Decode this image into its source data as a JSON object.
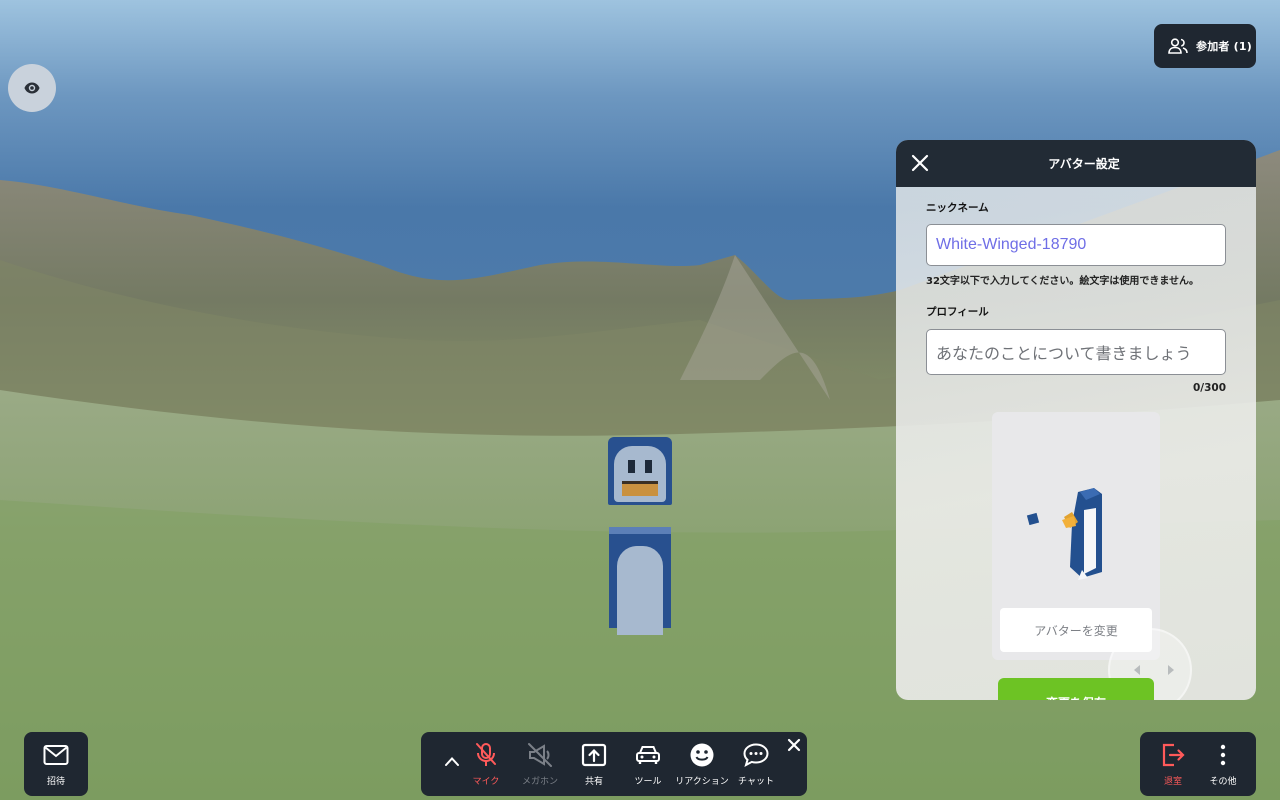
{
  "participants": {
    "label": "参加者 (1)"
  },
  "avatar_panel": {
    "title": "アバター設定",
    "nickname_label": "ニックネーム",
    "nickname_value": "White-Winged-18790",
    "nickname_hint": "32文字以下で入力してください。絵文字は使用できません。",
    "profile_label": "プロフィール",
    "profile_placeholder": "あなたのことについて書きましょう",
    "profile_counter": "0/300",
    "change_avatar_label": "アバターを変更",
    "save_label": "変更を保存"
  },
  "bottom_left": {
    "invite_label": "招待"
  },
  "toolbar": {
    "items": [
      {
        "label": "マイク",
        "icon": "mic-off-icon"
      },
      {
        "label": "メガホン",
        "icon": "megaphone-off-icon"
      },
      {
        "label": "共有",
        "icon": "share-screen-icon"
      },
      {
        "label": "ツール",
        "icon": "car-icon"
      },
      {
        "label": "リアクション",
        "icon": "smile-icon"
      },
      {
        "label": "チャット",
        "icon": "chat-icon"
      }
    ]
  },
  "bottom_right": {
    "leave_label": "退室",
    "more_label": "その他"
  },
  "colors": {
    "danger": "#ff5a5a",
    "accent_green": "#6dc324",
    "dark_tile": "#1f2731",
    "nickname_text": "#6f6ee6"
  }
}
